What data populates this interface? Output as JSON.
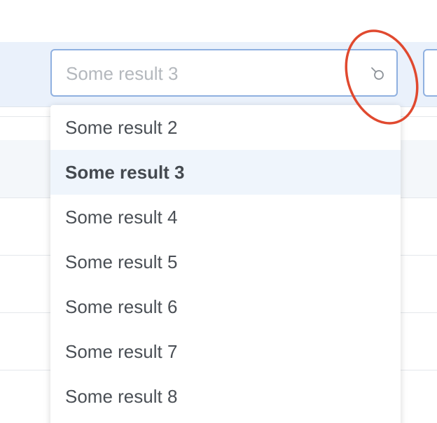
{
  "search": {
    "placeholder": "Some result 3",
    "icon": "search-icon"
  },
  "dropdown": {
    "options": [
      {
        "label": "Some result 2",
        "active": false
      },
      {
        "label": "Some result 3",
        "active": true
      },
      {
        "label": "Some result 4",
        "active": false
      },
      {
        "label": "Some result 5",
        "active": false
      },
      {
        "label": "Some result 6",
        "active": false
      },
      {
        "label": "Some result 7",
        "active": false
      },
      {
        "label": "Some result 8",
        "active": false
      }
    ]
  },
  "colors": {
    "field_border": "#8fb0e0",
    "header_band": "#eaf1fb",
    "active_option_bg": "#eff5fc",
    "annotation": "#e0492f",
    "option_text": "#4a4f55",
    "placeholder_text": "#b4b8bd"
  }
}
